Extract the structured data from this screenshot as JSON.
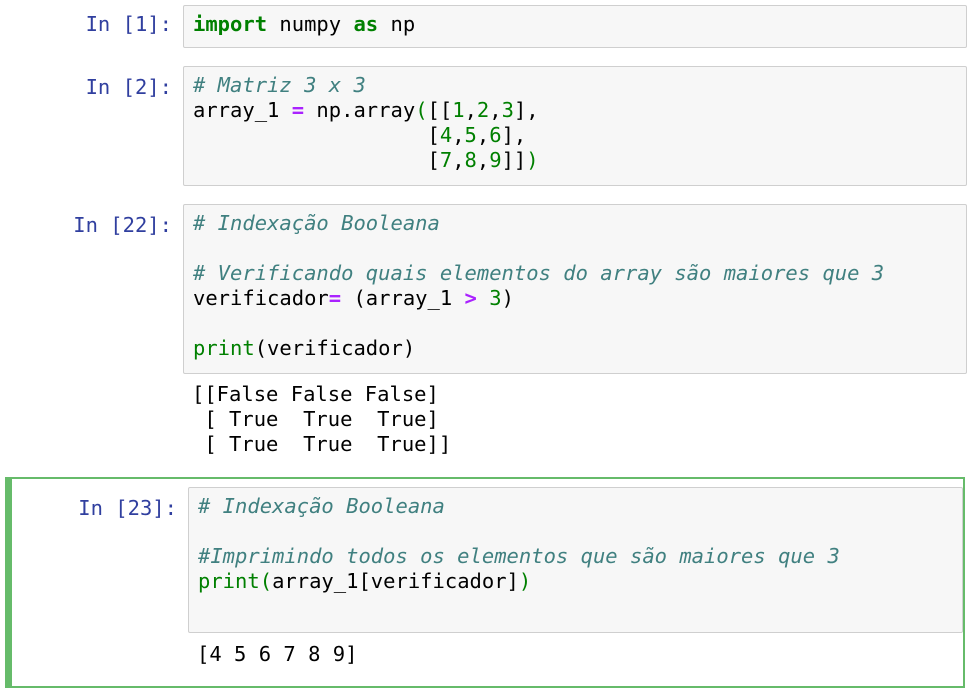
{
  "cells": [
    {
      "prompt": "In [1]:",
      "tokens": [
        [
          {
            "t": "import",
            "c": "kw"
          },
          {
            "t": " numpy ",
            "c": ""
          },
          {
            "t": "as",
            "c": "kw"
          },
          {
            "t": " np",
            "c": ""
          }
        ]
      ]
    },
    {
      "prompt": "In [2]:",
      "tokens": [
        [
          {
            "t": "# Matriz 3 x 3",
            "c": "cm"
          }
        ],
        [
          {
            "t": "array_1 ",
            "c": ""
          },
          {
            "t": "=",
            "c": "op"
          },
          {
            "t": " np.array",
            "c": ""
          },
          {
            "t": "(",
            "c": "br"
          },
          {
            "t": "[[",
            "c": ""
          },
          {
            "t": "1",
            "c": "num"
          },
          {
            "t": ",",
            "c": ""
          },
          {
            "t": "2",
            "c": "num"
          },
          {
            "t": ",",
            "c": ""
          },
          {
            "t": "3",
            "c": "num"
          },
          {
            "t": "],",
            "c": ""
          }
        ],
        [
          {
            "t": "                   [",
            "c": ""
          },
          {
            "t": "4",
            "c": "num"
          },
          {
            "t": ",",
            "c": ""
          },
          {
            "t": "5",
            "c": "num"
          },
          {
            "t": ",",
            "c": ""
          },
          {
            "t": "6",
            "c": "num"
          },
          {
            "t": "],",
            "c": ""
          }
        ],
        [
          {
            "t": "                   [",
            "c": ""
          },
          {
            "t": "7",
            "c": "num"
          },
          {
            "t": ",",
            "c": ""
          },
          {
            "t": "8",
            "c": "num"
          },
          {
            "t": ",",
            "c": ""
          },
          {
            "t": "9",
            "c": "num"
          },
          {
            "t": "]]",
            "c": ""
          },
          {
            "t": ")",
            "c": "br"
          }
        ]
      ]
    },
    {
      "prompt": "In [22]:",
      "tokens": [
        [
          {
            "t": "# Indexação Booleana",
            "c": "cm"
          }
        ],
        [],
        [
          {
            "t": "# Verificando quais elementos do array são maiores que 3",
            "c": "cm"
          }
        ],
        [
          {
            "t": "verificador",
            "c": ""
          },
          {
            "t": "=",
            "c": "op"
          },
          {
            "t": " (array_1 ",
            "c": ""
          },
          {
            "t": ">",
            "c": "op"
          },
          {
            "t": " ",
            "c": ""
          },
          {
            "t": "3",
            "c": "num"
          },
          {
            "t": ")",
            "c": ""
          }
        ],
        [],
        [
          {
            "t": "print",
            "c": "bi"
          },
          {
            "t": "(verificador)",
            "c": ""
          }
        ]
      ],
      "output": "[[False False False]\n [ True  True  True]\n [ True  True  True]]"
    },
    {
      "prompt": "In [23]:",
      "tokens": [
        [
          {
            "t": "# Indexação Booleana",
            "c": "cm"
          }
        ],
        [],
        [
          {
            "t": "#Imprimindo todos os elementos que são maiores que 3",
            "c": "cm"
          }
        ],
        [
          {
            "t": "print",
            "c": "bi"
          },
          {
            "t": "(",
            "c": "br"
          },
          {
            "t": "array_1[verificador]",
            "c": ""
          },
          {
            "t": ")",
            "c": "br"
          }
        ],
        []
      ],
      "output": "[4 5 6 7 8 9]",
      "selected": true
    }
  ]
}
